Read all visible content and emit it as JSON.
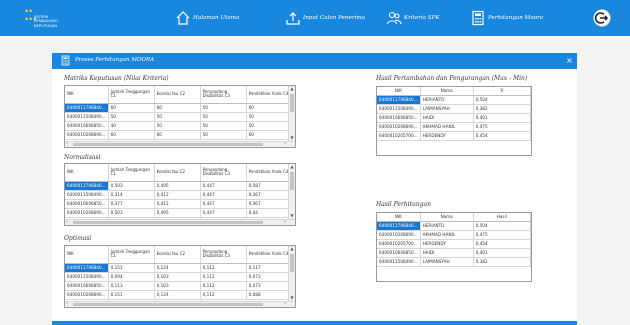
{
  "brand": {
    "logo_text": [
      "SISTEM",
      "PENDUKUNG",
      "KEPUTUSAN"
    ],
    "logo_icon": "sparkle-dots-logo"
  },
  "nav": [
    {
      "label": "Halaman Utama",
      "icon": "home-icon"
    },
    {
      "label": "Input Calon Penerima",
      "icon": "upload-icon"
    },
    {
      "label": "Kriteria SPK",
      "icon": "users-icon"
    },
    {
      "label": "Perhitungan Moora",
      "icon": "calculator-icon"
    }
  ],
  "card": {
    "title": "Proses Perhitungan MOORA",
    "close_symbol": "×"
  },
  "matriks": {
    "title": "Matriks Keputusan (Nilai Kriteria)",
    "headers": [
      "NIK",
      "Jumlah Tanggungan C1",
      "Kondisi Ibu C2",
      "Penyandang Disabilitas C3",
      "Pendidikan Anak C4"
    ],
    "rows": [
      [
        "6400011706840...",
        "60",
        "60",
        "50",
        "60"
      ],
      [
        "6400011508490...",
        "50",
        "50",
        "50",
        "50"
      ],
      [
        "6400010606850...",
        "40",
        "50",
        "50",
        "50"
      ],
      [
        "6400010208690...",
        "60",
        "60",
        "50",
        "60"
      ]
    ]
  },
  "normalisasi": {
    "title": "Normalisasi",
    "headers": [
      "NIK",
      "Jumlah Tanggungan C1",
      "Kondisi Ibu C2",
      "Penyandang Disabilitas C3",
      "Pendidikan Anak C4"
    ],
    "rows": [
      [
        "6400011706840...",
        "0,503",
        "0,495",
        "0,447",
        "0,587"
      ],
      [
        "6400011508490...",
        "0,314",
        "0,412",
        "0,447",
        "0,367"
      ],
      [
        "6400010606850...",
        "0,377",
        "0,412",
        "0,447",
        "0,367"
      ],
      [
        "6400010208690...",
        "0,503",
        "0,495",
        "0,447",
        "0,44"
      ]
    ]
  },
  "optimasi": {
    "title": "Optimasi",
    "headers": [
      "NIK",
      "Jumlah Tanggungan C1",
      "Kondisi Ibu C2",
      "Penyandang Disabilitas C3",
      "Pendidikan Anak C4"
    ],
    "rows": [
      [
        "6400011706840...",
        "0,151",
        "0,124",
        "0,112",
        "0,117"
      ],
      [
        "6400011508490...",
        "0,094",
        "0,103",
        "0,112",
        "0,073"
      ],
      [
        "6400010606850...",
        "0,113",
        "0,103",
        "0,112",
        "0,073"
      ],
      [
        "6400010208690...",
        "0,151",
        "0,124",
        "0,112",
        "0,088"
      ]
    ]
  },
  "hasil_pertambahan": {
    "title": "Hasil Pertambahan dan Pengurangan (Max - Min)",
    "headers": [
      "NIK",
      "Nama",
      "Yi"
    ],
    "rows": [
      [
        "6400011706840...",
        "HERIANTO",
        "0,504"
      ],
      [
        "6400011508490...",
        "LAIMANSYAH",
        "0,382"
      ],
      [
        "6400010606850...",
        "HAIDI",
        "0,401"
      ],
      [
        "6400010208690...",
        "AKHMAD HANIL",
        "0,475"
      ],
      [
        "6400010205700...",
        "HERDENDY",
        "0,454"
      ]
    ]
  },
  "hasil_perhitungan": {
    "title": "Hasil Perhitungan",
    "headers": [
      "NIK",
      "Nama",
      "Hasil"
    ],
    "rows": [
      [
        "6400011706840...",
        "HERIANTO",
        "0,504"
      ],
      [
        "6400010208690...",
        "AKHMAD HANIL",
        "0,475"
      ],
      [
        "6400010205700...",
        "HERDENDY",
        "0,454"
      ],
      [
        "6400010606850...",
        "HAIDI",
        "0,401"
      ],
      [
        "6400011508490...",
        "LAIMANSYAH",
        "0,382"
      ]
    ]
  },
  "colors": {
    "primary": "#1a87de",
    "selected_row": "#1877d1"
  }
}
